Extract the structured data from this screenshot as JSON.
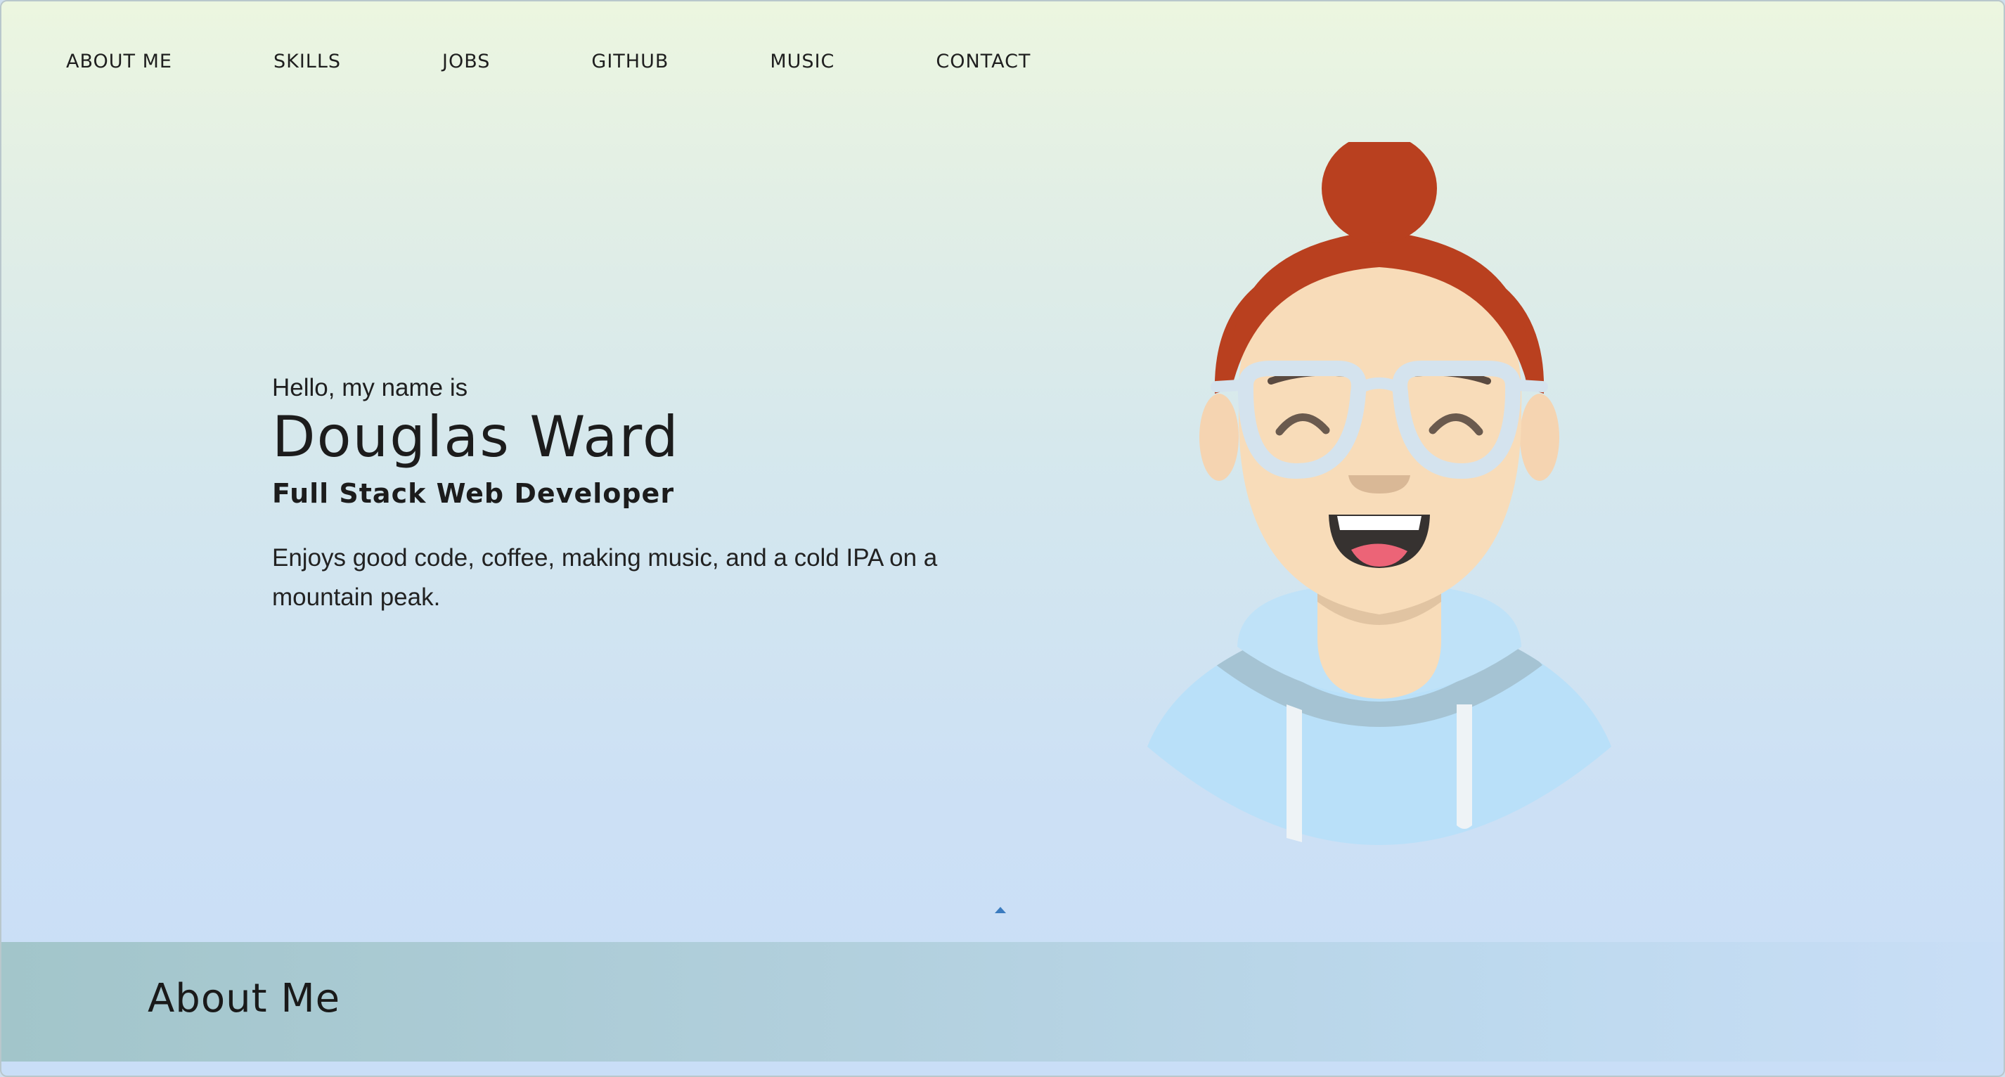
{
  "nav": {
    "items": [
      {
        "label": "ABOUT ME"
      },
      {
        "label": "SKILLS"
      },
      {
        "label": "JOBS"
      },
      {
        "label": "GITHUB"
      },
      {
        "label": "MUSIC"
      },
      {
        "label": "CONTACT"
      }
    ]
  },
  "hero": {
    "greeting": "Hello, my name is",
    "name": "Douglas Ward",
    "role": "Full Stack Web Developer",
    "bio": "Enjoys good code, coffee, making music, and a cold IPA on a mountain peak."
  },
  "avatar": {
    "icon": "developer-avatar-illustration",
    "colors": {
      "hair": "#b9401f",
      "skin": "#f8dcb9",
      "hoodie": "#b9e0f9",
      "glasses": "#d4e3ee"
    }
  },
  "scroll_indicator": {
    "icon": "caret-up-icon",
    "color": "#3b7bbf"
  },
  "about": {
    "title": "About Me"
  }
}
